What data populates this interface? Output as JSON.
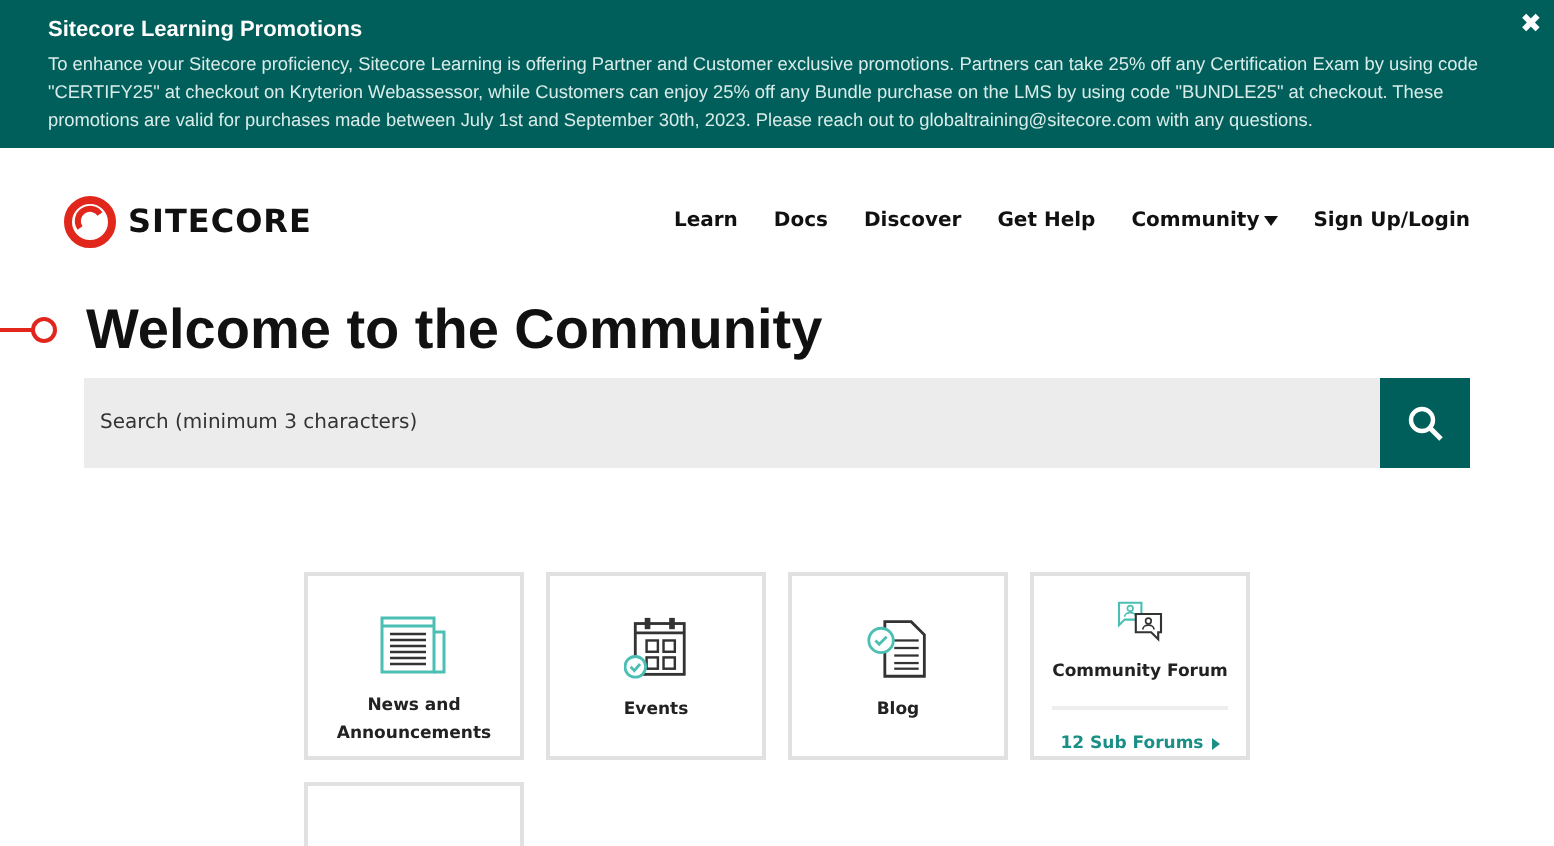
{
  "banner": {
    "title": "Sitecore Learning Promotions",
    "text": "To enhance your Sitecore proficiency, Sitecore Learning is offering Partner and Customer exclusive promotions. Partners can take 25% off any Certification Exam by using code \"CERTIFY25\" at checkout on Kryterion Webassessor, while Customers can enjoy 25% off any Bundle purchase on the LMS by using code \"BUNDLE25\" at checkout. These promotions are valid for purchases made between July 1st and September 30th, 2023. Please reach out to globaltraining@sitecore.com with any questions.",
    "close": "✖"
  },
  "header": {
    "logo": "SITECORE",
    "nav": [
      {
        "label": "Learn",
        "kind": "link"
      },
      {
        "label": "Docs",
        "kind": "link"
      },
      {
        "label": "Discover",
        "kind": "link"
      },
      {
        "label": "Get Help",
        "kind": "link"
      },
      {
        "label": "Community",
        "kind": "dropdown"
      },
      {
        "label": "Sign Up/Login",
        "kind": "link"
      }
    ]
  },
  "page_title": "Welcome to the Community",
  "search": {
    "placeholder": "Search (minimum 3 characters)"
  },
  "cards": [
    {
      "kind": "tile",
      "label": "News and Announcements"
    },
    {
      "kind": "tile",
      "label": "Events"
    },
    {
      "kind": "tile",
      "label": "Blog"
    },
    {
      "kind": "tile",
      "label": "Community Forum",
      "link": "12 Sub Forums"
    },
    {
      "kind": "partial"
    }
  ]
}
